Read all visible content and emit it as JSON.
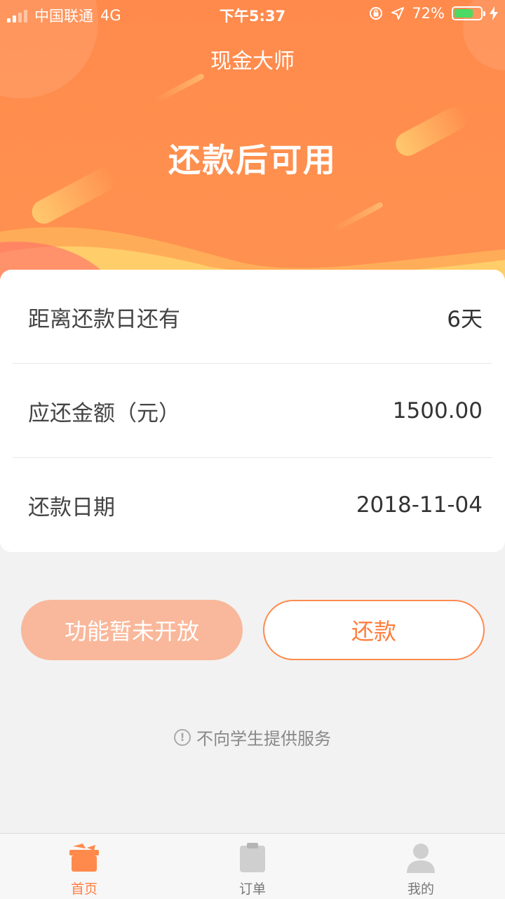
{
  "status_bar": {
    "carrier": "中国联通",
    "network": "4G",
    "time": "下午5:37",
    "battery_percent": "72%",
    "battery_level": 0.72
  },
  "header": {
    "app_title": "现金大师",
    "headline": "还款后可用"
  },
  "loan_info": {
    "rows": [
      {
        "label": "距离还款日还有",
        "value": "6天"
      },
      {
        "label": "应还金额（元）",
        "value": "1500.00"
      },
      {
        "label": "还款日期",
        "value": "2018-11-04"
      }
    ]
  },
  "actions": {
    "disabled_label": "功能暂未开放",
    "repay_label": "还款"
  },
  "notice": {
    "icon": "info-circle-icon",
    "text": "不向学生提供服务"
  },
  "tabbar": {
    "tabs": [
      {
        "label": "首页",
        "icon": "home-gift-icon",
        "active": true
      },
      {
        "label": "订单",
        "icon": "clipboard-icon",
        "active": false
      },
      {
        "label": "我的",
        "icon": "user-icon",
        "active": false
      }
    ]
  },
  "colors": {
    "brand": "#ff8a4c",
    "accent_text": "#ff7e3e",
    "disabled_button": "#f9b89b",
    "battery_fill": "#4cd964"
  }
}
